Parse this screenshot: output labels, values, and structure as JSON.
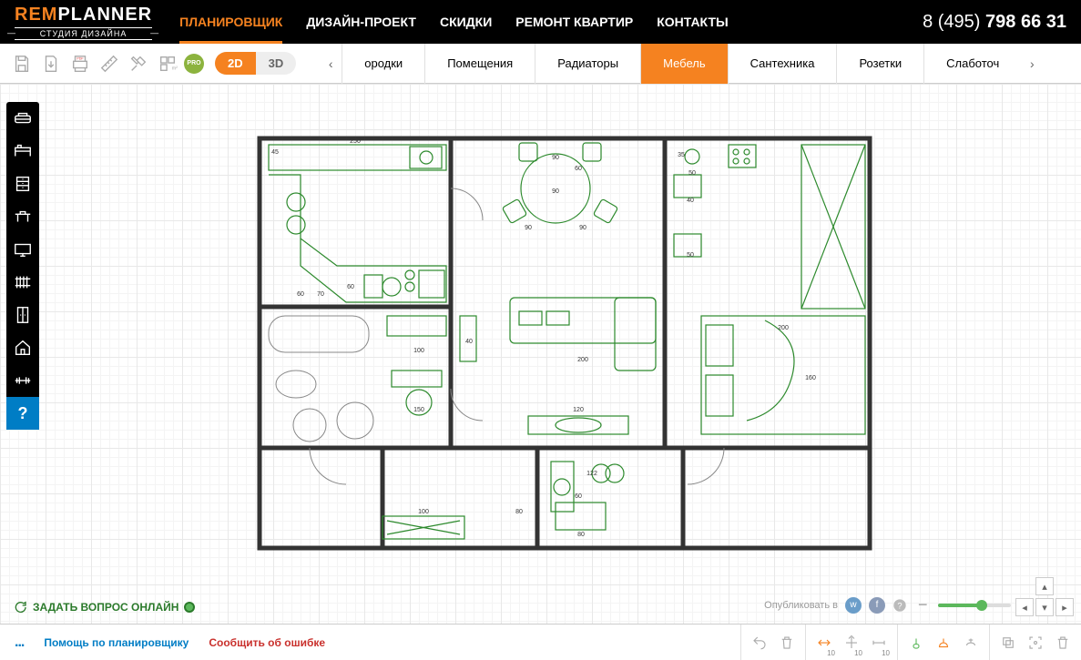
{
  "logo": {
    "rem": "REM",
    "planner": "PLANNER",
    "sub": "СТУДИЯ ДИЗАЙНА"
  },
  "nav": [
    {
      "label": "ПЛАНИРОВЩИК",
      "active": true
    },
    {
      "label": "ДИЗАЙН-ПРОЕКТ"
    },
    {
      "label": "СКИДКИ"
    },
    {
      "label": "РЕМОНТ КВАРТИР"
    },
    {
      "label": "КОНТАКТЫ"
    }
  ],
  "phone": {
    "prefix": "8 (495) ",
    "number": "798 66 31"
  },
  "view": {
    "d2": "2D",
    "d3": "3D"
  },
  "pro": "PRO",
  "tabs": {
    "partial_left": "ородки",
    "items": [
      "Помещения",
      "Радиаторы",
      "Мебель",
      "Сантехника",
      "Розетки"
    ],
    "partial_right": "Слаботоч",
    "active": "Мебель"
  },
  "sidebar_help": "?",
  "ask": {
    "label": "ЗАДАТЬ ВОПРОС ОНЛАЙН"
  },
  "publish": "Опубликовать в",
  "footer": {
    "more": "...",
    "help": "Помощь по планировщику",
    "error": "Сообщить об ошибке",
    "snap10a": "10",
    "snap10b": "10",
    "snap10c": "10"
  },
  "dims": {
    "d250": "250",
    "d45": "45",
    "d90a": "90",
    "d90b": "90",
    "d35": "35",
    "d50": "50",
    "d60a": "60",
    "d60b": "60",
    "d60c": "60",
    "d60d": "60",
    "d90c": "90",
    "d90d": "90",
    "d40a": "40",
    "d40b": "40",
    "d50b": "50",
    "d70": "70",
    "d100a": "100",
    "d100b": "100",
    "d120": "120",
    "d122": "122",
    "d150": "150",
    "d160": "160",
    "d200a": "200",
    "d200b": "200",
    "d80a": "80",
    "d80b": "80"
  }
}
